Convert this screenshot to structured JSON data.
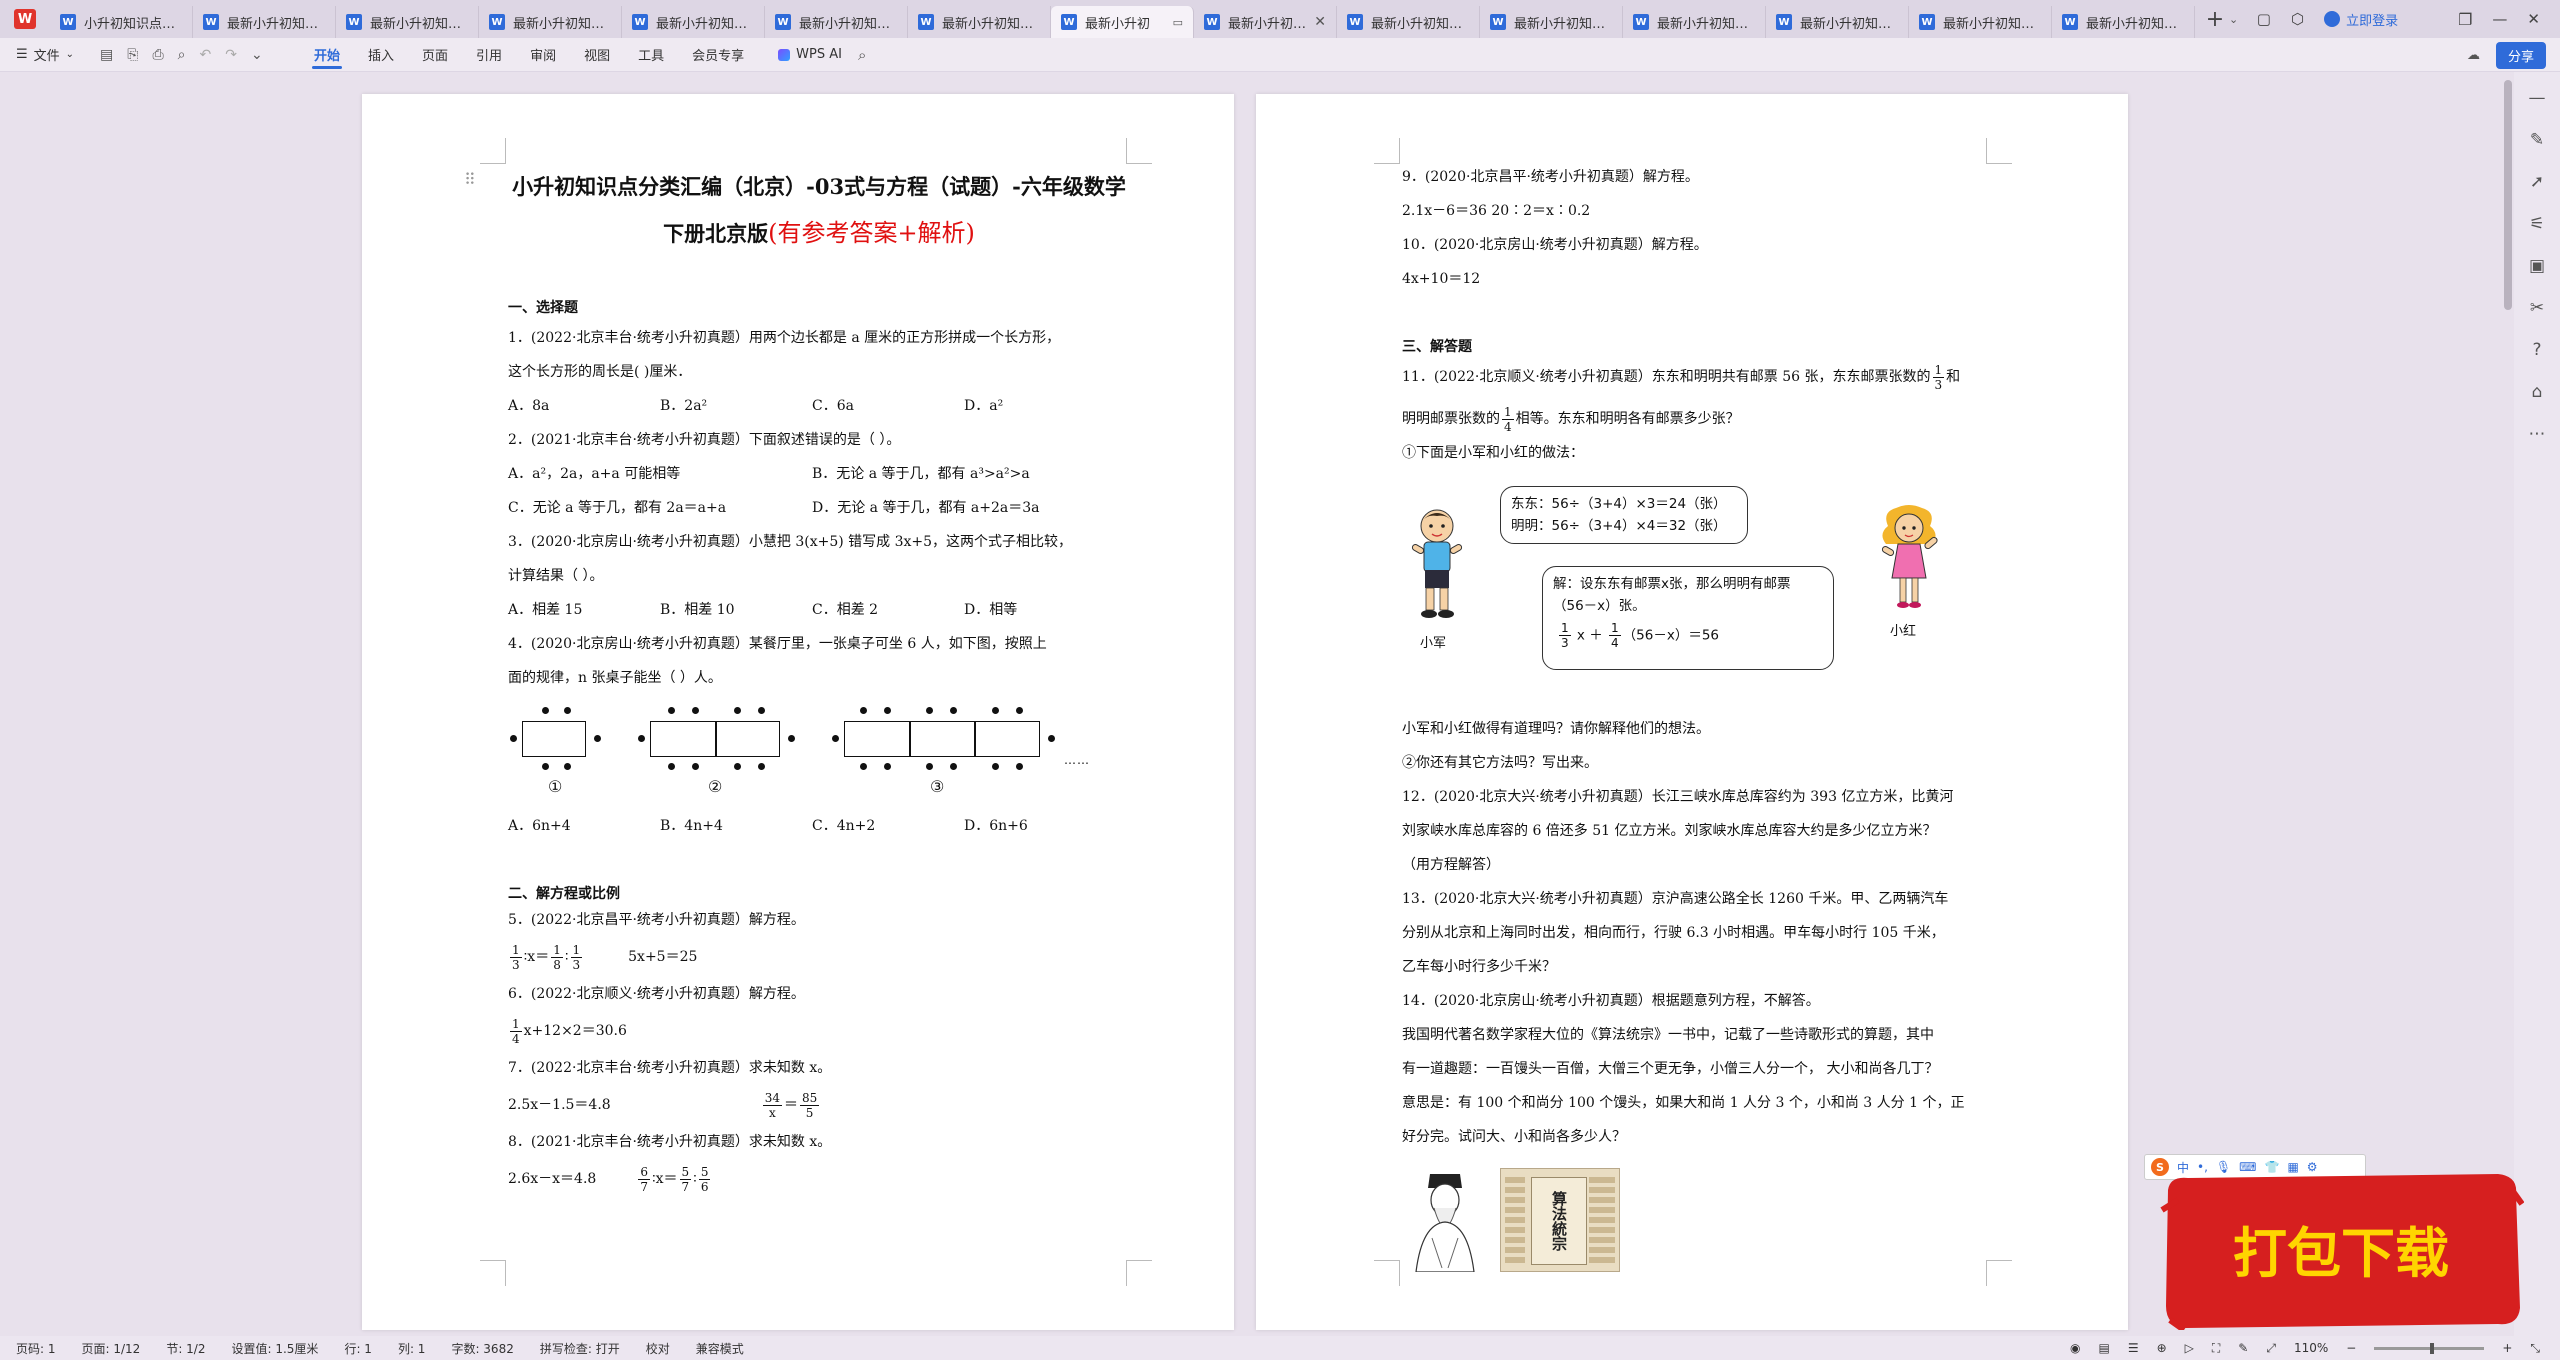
{
  "tabs": [
    {
      "label": "小升初知识点分类",
      "active": false
    },
    {
      "label": "最新小升初知识点",
      "active": false
    },
    {
      "label": "最新小升初知识点",
      "active": false
    },
    {
      "label": "最新小升初知识点",
      "active": false
    },
    {
      "label": "最新小升初知识点",
      "active": false
    },
    {
      "label": "最新小升初知识点",
      "active": false
    },
    {
      "label": "最新小升初知识点",
      "active": false
    },
    {
      "label": "最新小升初",
      "active": true
    },
    {
      "label": "最新小升初知识",
      "active": false,
      "closable": true
    },
    {
      "label": "最新小升初知识点",
      "active": false
    },
    {
      "label": "最新小升初知识点",
      "active": false
    },
    {
      "label": "最新小升初知识点",
      "active": false
    },
    {
      "label": "最新小升初知识点",
      "active": false
    },
    {
      "label": "最新小升初知识点",
      "active": false
    },
    {
      "label": "最新小升初知识点",
      "active": false
    }
  ],
  "app_logo": "W",
  "login_label": "立即登录",
  "share_label": "分享",
  "file_menu": "文件",
  "menu": [
    "开始",
    "插入",
    "页面",
    "引用",
    "审阅",
    "视图",
    "工具",
    "会员专享"
  ],
  "wps_ai": "WPS AI",
  "page1": {
    "title_a": "小升初知识点分类汇编（北京）-03式与方程（试题）-六年级数学下册北京版",
    "title_red": "(有参考答案+解析)",
    "sec1": "一、选择题",
    "q1": "1．(2022·北京丰台·统考小升初真题）用两个边长都是 a 厘米的正方形拼成一个长方形，",
    "q1b": "这个长方形的周长是(    )厘米．",
    "q1_opts": [
      "A．8a",
      "B．2a²",
      "C．6a",
      "D．a²"
    ],
    "q2": "2．(2021·北京丰台·统考小升初真题）下面叙述错误的是（    ）。",
    "q2_opts": [
      "A．a²，2a，a+a 可能相等",
      "B．无论 a 等于几，都有 a³>a²>a",
      "C．无论 a 等于几，都有 2a＝a+a",
      "D．无论 a 等于几，都有 a+2a＝3a"
    ],
    "q3": "3．(2020·北京房山·统考小升初真题）小慧把 3(x+5) 错写成 3x+5，这两个式子相比较，",
    "q3b": "计算结果（    ）。",
    "q3_opts": [
      "A．相差 15",
      "B．相差 10",
      "C．相差 2",
      "D．相等"
    ],
    "q4": "4．(2020·北京房山·统考小升初真题）某餐厅里，一张桌子可坐 6 人，如下图，按照上",
    "q4b": "面的规律，n 张桌子能坐（    ）人。",
    "q4_circles": [
      "①",
      "②",
      "③"
    ],
    "q4_more": "……",
    "q4_opts": [
      "A．6n+4",
      "B．4n+4",
      "C．4n+2",
      "D．6n+6"
    ],
    "sec2": "二、解方程或比例",
    "q5": "5．(2022·北京昌平·统考小升初真题）解方程。",
    "q5_eq_a": "x＝",
    "q5_eq_b": "5x+5＝25",
    "q6": "6．(2022·北京顺义·统考小升初真题）解方程。",
    "q6_eq": "x+12×2＝30.6",
    "q7": "7．(2022·北京丰台·统考小升初真题）求未知数 x。",
    "q7_eq_a": "2.5x－1.5＝4.8",
    "q8": "8．(2021·北京丰台·统考小升初真题）求未知数 x。",
    "q8_eq_a": "2.6x－x＝4.8"
  },
  "page2": {
    "q9": "9．(2020·北京昌平·统考小升初真题）解方程。",
    "q9_eq": "2.1x－6＝36    20∶2＝x∶0.2",
    "q10": "10．(2020·北京房山·统考小升初真题）解方程。",
    "q10_eq": "4x+10＝12",
    "sec3": "三、解答题",
    "q11a": "11．(2022·北京顺义·统考小升初真题）东东和明明共有邮票 56 张，东东邮票张数的",
    "q11a_end": "和",
    "q11b": "明明邮票张数的",
    "q11b_end": "相等。东东和明明各有邮票多少张？",
    "q11c": "①下面是小军和小红的做法：",
    "bubble1_l1": "东东：56÷（3+4）×3＝24（张）",
    "bubble1_l2": "明明：56÷（3+4）×4＝32（张）",
    "bubble2_l1": "解：设东东有邮票x张，那么明明有邮票",
    "bubble2_l2": "（56－x）张。",
    "bubble2_eq": "（56－x）＝56",
    "boy_label": "小军",
    "girl_label": "小红",
    "q11d": "小军和小红做得有道理吗？请你解释他们的想法。",
    "q11e": "②你还有其它方法吗？写出来。",
    "q12a": "12．(2020·北京大兴·统考小升初真题）长江三峡水库总库容约为 393 亿立方米，比黄河",
    "q12b": "刘家峡水库总库容的 6 倍还多 51 亿立方米。刘家峡水库总库容大约是多少亿立方米？",
    "q12c": "（用方程解答）",
    "q13a": "13．(2020·北京大兴·统考小升初真题）京沪高速公路全长 1260 千米。甲、乙两辆汽车",
    "q13b": "分别从北京和上海同时出发，相向而行，行驶 6.3 小时相遇。甲车每小时行 105 千米，",
    "q13c": "乙车每小时行多少千米？",
    "q14a": "14．(2020·北京房山·统考小升初真题）根据题意列方程，不解答。",
    "q14b": "我国明代著名数学家程大位的《算法统宗》一书中，记载了一些诗歌形式的算题，其中",
    "q14c": "有一道趣题：一百馒头一百僧，大僧三个更无争，小僧三人分一个，  大小和尚各几丁？",
    "q14d": "意思是：有 100 个和尚分 100 个馒头，如果大和尚 1 人分 3 个，小和尚 3 人分 1 个，正",
    "q14e": "好分完。试问大、小和尚各多少人？",
    "book_title": "算法統宗"
  },
  "download_label": "打包下载",
  "ime_label": "中",
  "status": {
    "page": "页码: 1",
    "pages": "页面: 1/12",
    "section": "节: 1/2",
    "setting": "设置值: 1.5厘米",
    "row": "行: 1",
    "col": "列: 1",
    "words": "字数: 3682",
    "spell": "拼写检查: 打开",
    "proof": "校对",
    "compat": "兼容模式",
    "zoom": "110%"
  },
  "colors": {
    "accent": "#2f6bd9",
    "title_red": "#e01010",
    "banner_red": "#d61f1f",
    "banner_text": "#ffd500"
  }
}
